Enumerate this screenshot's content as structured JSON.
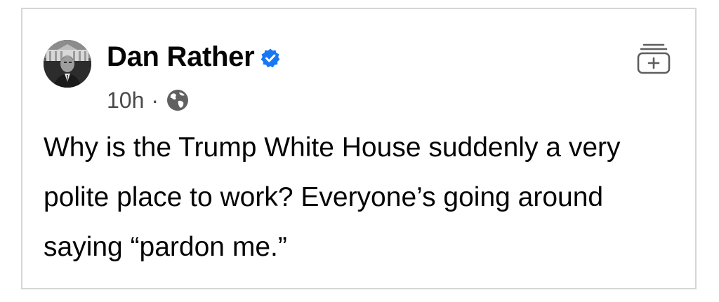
{
  "post": {
    "author": {
      "name": "Dan Rather",
      "verified": true,
      "avatar_icon": "profile-photo-avatar"
    },
    "timestamp": "10h",
    "separator": "·",
    "audience_icon": "globe-icon",
    "save_icon": "collection-add-icon",
    "text": "Why is the Trump White House suddenly a very polite place to work? Everyone’s going around saying “pardon me.”"
  },
  "colors": {
    "verified_badge": "#1877f2",
    "text": "#050505",
    "meta_text": "#4a4a4a",
    "border": "#d6d6d6"
  }
}
